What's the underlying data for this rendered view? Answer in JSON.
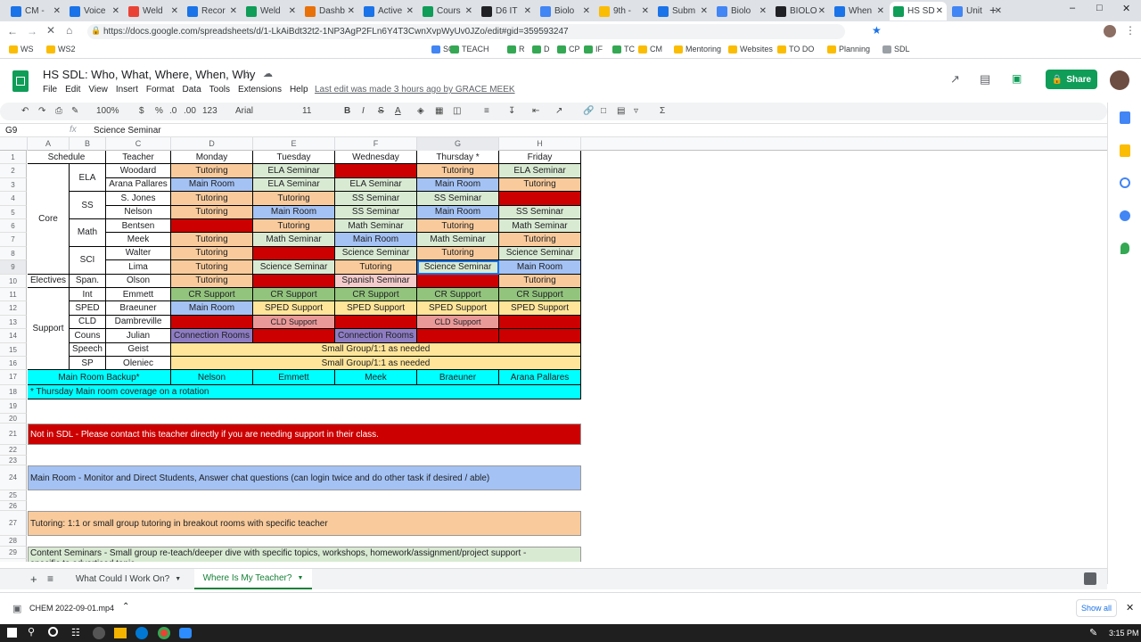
{
  "browser_tabs": [
    {
      "label": "CM -",
      "color": "#1a73e8"
    },
    {
      "label": "Voice",
      "color": "#1a73e8"
    },
    {
      "label": "Weld",
      "color": "#ea4335"
    },
    {
      "label": "Recor",
      "color": "#1a73e8"
    },
    {
      "label": "Weld",
      "color": "#0f9d58"
    },
    {
      "label": "Dashb",
      "color": "#e8710a"
    },
    {
      "label": "Active",
      "color": "#1a73e8"
    },
    {
      "label": "Cours",
      "color": "#0f9d58"
    },
    {
      "label": "D6 IT",
      "color": "#202124"
    },
    {
      "label": "Biolo",
      "color": "#4285f4"
    },
    {
      "label": "9th -",
      "color": "#fbbc04"
    },
    {
      "label": "Subm",
      "color": "#1a73e8"
    },
    {
      "label": "Biolo",
      "color": "#4285f4"
    },
    {
      "label": "BIOLO",
      "color": "#202124"
    },
    {
      "label": "When",
      "color": "#1a73e8"
    },
    {
      "label": "HS SD",
      "color": "#0f9d58",
      "active": true
    },
    {
      "label": "Unit",
      "color": "#4285f4"
    }
  ],
  "url": "https://docs.google.com/spreadsheets/d/1-LkAiBdt32t2-1NP3AgP2FLn6Y4T3CwnXvpWyUv0JZo/edit#gid=359593247",
  "bookmarks": [
    "WS",
    "WS2",
    "SC",
    "TEACH",
    "R",
    "D",
    "CP",
    "IF",
    "TC",
    "CM",
    "Mentoring",
    "Websites",
    "TO DO",
    "Planning",
    "SDL"
  ],
  "doc": {
    "title": "HS SDL: Who, What, Where, When, Why",
    "menus": [
      "File",
      "Edit",
      "View",
      "Insert",
      "Format",
      "Data",
      "Tools",
      "Extensions",
      "Help"
    ],
    "last_edit": "Last edit was made 3 hours ago by GRACE MEEK",
    "share_label": "Share"
  },
  "toolbar": {
    "zoom": "100%",
    "currency": "$",
    "percent": "%",
    "dec0": ".0",
    "dec00": ".00",
    "fmt123": "123",
    "font": "Arial",
    "font_size": "11",
    "bold": "B",
    "italic": "I",
    "strike": "S",
    "textcolor": "A"
  },
  "formula": {
    "cell_ref": "G9",
    "fx": "fx",
    "content": "Science Seminar"
  },
  "columns": [
    "A",
    "B",
    "C",
    "D",
    "E",
    "F",
    "G",
    "H"
  ],
  "rows": [
    "1",
    "2",
    "3",
    "4",
    "5",
    "6",
    "7",
    "8",
    "9",
    "10",
    "11",
    "12",
    "13",
    "14",
    "15",
    "16",
    "17",
    "18",
    "19",
    "20",
    "21",
    "22",
    "23",
    "24",
    "25",
    "26",
    "27",
    "28",
    "29",
    "30",
    "31"
  ],
  "grid": {
    "header": [
      "Schedule",
      "Teacher",
      "Monday",
      "Tuesday",
      "Wednesday",
      "Thursday  *",
      "Friday"
    ],
    "groups": {
      "core": "Core",
      "electives": "Electives",
      "support": "Support"
    },
    "subjects": {
      "ela": "ELA",
      "ss": "SS",
      "math": "Math",
      "sci": "SCI",
      "span": "Span.",
      "int": "Int",
      "sped": "SPED",
      "cld": "CLD",
      "couns": "Couns",
      "speech": "Speech",
      "sp": "SP"
    },
    "teachers": [
      "Woodard",
      "Arana Pallares",
      "S. Jones",
      "Nelson",
      "Bentsen",
      "Meek",
      "Walter",
      "Lima",
      "Olson",
      "Emmett",
      "Braeuner",
      "Dambreville",
      "Julian",
      "Geist",
      "Oleniec"
    ],
    "schedule": [
      [
        "Tutoring",
        "ELA Seminar",
        "",
        "Tutoring",
        "ELA Seminar"
      ],
      [
        "Main Room",
        "ELA Seminar",
        "ELA Seminar",
        "Main Room",
        "Tutoring"
      ],
      [
        "Tutoring",
        "Tutoring",
        "SS Seminar",
        "SS Seminar",
        ""
      ],
      [
        "Tutoring",
        "Main Room",
        "SS Seminar",
        "Main Room",
        "SS Seminar"
      ],
      [
        "",
        "Tutoring",
        "Math Seminar",
        "Tutoring",
        "Math Seminar"
      ],
      [
        "Tutoring",
        "Math Seminar",
        "Main Room",
        "Math Seminar",
        "Tutoring"
      ],
      [
        "Tutoring",
        "",
        "Science Seminar",
        "Tutoring",
        "Science Seminar"
      ],
      [
        "Tutoring",
        "Science Seminar",
        "Tutoring",
        "Science Seminar",
        "Main Room"
      ],
      [
        "Tutoring",
        "",
        "Spanish Seminar",
        "",
        "Tutoring"
      ],
      [
        "CR Support",
        "CR Support",
        "CR Support",
        "CR Support",
        "CR Support"
      ],
      [
        "Main Room",
        "SPED Support",
        "SPED Support",
        "SPED Support",
        "SPED Support"
      ],
      [
        "",
        "CLD Support",
        "",
        "CLD Support",
        ""
      ],
      [
        "Connection Rooms",
        "",
        "Connection Rooms",
        "",
        ""
      ]
    ],
    "small_group": "Small Group/1:1 as needed",
    "backup_label": "Main Room Backup*",
    "backup": [
      "Nelson",
      "Emmett",
      "Meek",
      "Braeuner",
      "Arana Pallares"
    ],
    "thursday_note": "* Thursday Main room coverage on a rotation"
  },
  "legend": {
    "not_in_sdl": "Not in SDL - Please contact this teacher directly if you are needing support in their class.",
    "main_room": "Main Room - Monitor and Direct Students, Answer chat questions (can login twice and do other task if desired / able)",
    "tutoring": "Tutoring: 1:1 or small group tutoring in breakout rooms with specific teacher",
    "content_seminars": "Content Seminars - Small group re-teach/deeper dive with specific topics, workshops, homework/assignment/project support - specific to advertised topic"
  },
  "colors": {
    "tutoring": "#f9cb9c",
    "ela": "#d9ead3",
    "mainroom": "#a4c2f4",
    "red": "#cc0000",
    "cr": "#93c47d",
    "sped": "#ffe599",
    "cld": "#ea9999",
    "conn": "#8e7cc3",
    "small": "#ffe599",
    "cyan": "#00ffff",
    "seminar": "#d9ead3",
    "spanish": "#f4cccc"
  },
  "sheet_tabs": [
    {
      "label": "What Could I Work On?"
    },
    {
      "label": "Where Is My Teacher?",
      "active": true
    }
  ],
  "download": {
    "file": "CHEM 2022-09-01.mp4",
    "show_all": "Show all"
  },
  "clock": "3:15 PM"
}
